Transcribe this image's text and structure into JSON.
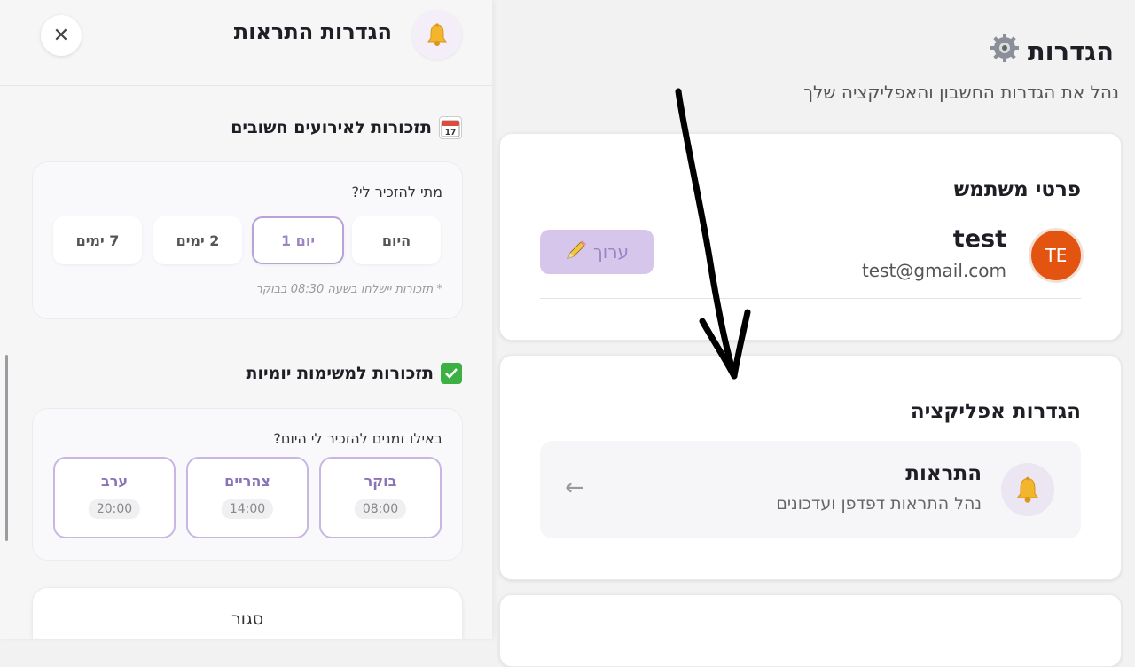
{
  "modal": {
    "title": "הגדרות התראות",
    "close_glyph": "✕",
    "events_section": {
      "title": "תזכורות לאירועים חשובים",
      "question": "מתי להזכיר לי?",
      "options": [
        "היום",
        "יום 1",
        "2 ימים",
        "7 ימים"
      ],
      "selected": "יום 1",
      "note": "* תזכורות יישלחו בשעה 08:30 בבוקר"
    },
    "tasks_section": {
      "title": "תזכורות למשימות יומיות",
      "question": "באילו זמנים להזכיר לי היום?",
      "times": [
        {
          "label": "בוקר",
          "time": "08:00"
        },
        {
          "label": "צהריים",
          "time": "14:00"
        },
        {
          "label": "ערב",
          "time": "20:00"
        }
      ]
    },
    "close_button": "סגור"
  },
  "settings": {
    "title": "הגדרות",
    "subtitle": "נהל את הגדרות החשבון והאפליקציה שלך",
    "user_card": {
      "heading": "פרטי משתמש",
      "avatar_initials": "TE",
      "name": "test",
      "email": "test@gmail.com",
      "edit_label": "ערוך"
    },
    "app_card": {
      "heading": "הגדרות אפליקציה",
      "notifications_title": "התראות",
      "notifications_sub": "נהל התראות דפדפן ועדכונים",
      "arrow_glyph": "←"
    }
  },
  "colors": {
    "accent": "#9c86c2",
    "avatar": "#e35410",
    "edit_bg": "#d6c6ec"
  }
}
